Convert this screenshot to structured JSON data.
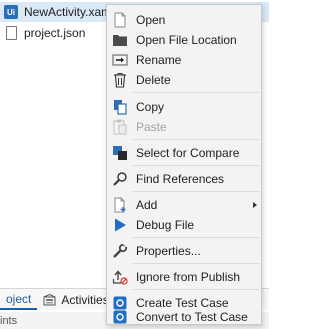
{
  "tree": {
    "items": [
      {
        "label": "NewActivity.xaml",
        "badge": "Ui",
        "icon": "xaml-file-icon",
        "selected": true
      },
      {
        "label": "project.json",
        "icon": "json-file-icon",
        "selected": false
      }
    ]
  },
  "bottom_panel": {
    "tabs": [
      {
        "label": "oject",
        "icon": "",
        "active": true
      },
      {
        "label": "Activities",
        "icon": "activities-icon",
        "active": false
      }
    ],
    "status_text": "ints"
  },
  "context_menu": {
    "items": [
      {
        "label": "Open",
        "icon": "document-icon",
        "enabled": true
      },
      {
        "label": "Open File Location",
        "icon": "folder-icon",
        "enabled": true
      },
      {
        "label": "Rename",
        "icon": "rename-icon",
        "enabled": true
      },
      {
        "label": "Delete",
        "icon": "trash-icon",
        "enabled": true
      },
      {
        "label": "Copy",
        "icon": "copy-icon",
        "enabled": true
      },
      {
        "label": "Paste",
        "icon": "paste-icon",
        "enabled": false
      },
      {
        "label": "Select for Compare",
        "icon": "compare-icon",
        "enabled": true
      },
      {
        "label": "Find References",
        "icon": "magnifier-icon",
        "enabled": true
      },
      {
        "label": "Add",
        "icon": "add-file-icon",
        "enabled": true,
        "submenu": true
      },
      {
        "label": "Debug File",
        "icon": "play-icon",
        "enabled": true
      },
      {
        "label": "Properties...",
        "icon": "wrench-icon",
        "enabled": true
      },
      {
        "label": "Ignore from Publish",
        "icon": "ignore-publish-icon",
        "enabled": true
      },
      {
        "label": "Create Test Case",
        "icon": "test-case-icon",
        "enabled": true
      },
      {
        "label": "Convert to Test Case",
        "icon": "test-case-icon",
        "enabled": true
      }
    ]
  },
  "colors": {
    "accent_blue": "#1f5faa",
    "selection": "#dbe9f7",
    "menu_background": "#f3f3f3",
    "disabled_text": "#a3a3a3"
  }
}
